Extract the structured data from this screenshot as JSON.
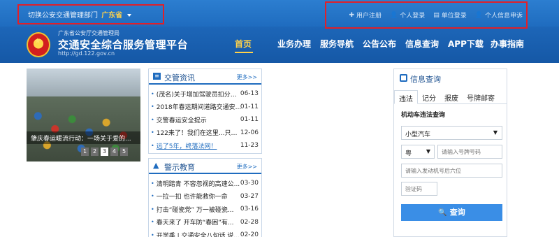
{
  "topbar": {
    "dept_prefix": "切换公安交通管理部门",
    "dept_province": "广东省",
    "links": [
      {
        "icon": "plus-icon",
        "label": "用户注册"
      },
      {
        "icon": "user-icon",
        "label": "个人登录"
      },
      {
        "icon": "building-icon",
        "label": "单位登录"
      },
      {
        "icon": "user-info-icon",
        "label": "个人信息申诉"
      }
    ]
  },
  "header": {
    "org": "广东省公安厅交通管理局",
    "title": "交通安全综合服务管理平台",
    "url": "http://gd.122.gov.cn"
  },
  "nav": [
    "首页",
    "业务办理",
    "服务导航",
    "公告公布",
    "信息查询",
    "APP下载",
    "办事指南"
  ],
  "carousel": {
    "caption": "肇庆春运暖流行动：一场关于爱的...",
    "pages": [
      "1",
      "2",
      "3",
      "4",
      "5"
    ],
    "active_page": 3
  },
  "news": {
    "title": "交管资讯",
    "more": "更多>>",
    "items": [
      {
        "title": "(茂名)关于增加驾驶员扣分、...",
        "date": "06-13"
      },
      {
        "title": "2018年春运期间道路交通安...",
        "date": "01-11"
      },
      {
        "title": "交警春运安全提示",
        "date": "01-11"
      },
      {
        "title": "122来了！我们在这里...只为...",
        "date": "12-06"
      },
      {
        "title": "远了5年，终落法网！",
        "date": "11-23"
      }
    ]
  },
  "warning": {
    "title": "警示教育",
    "more": "更多>>",
    "items": [
      {
        "title": "清明踏青 不容忽视的高速公...",
        "date": "03-30"
      },
      {
        "title": "一拉一扣 也许能救你一命",
        "date": "03-27"
      },
      {
        "title": "打击“碰瓷党” 万一被碰瓷...",
        "date": "03-16"
      },
      {
        "title": "春天来了 开车防“春困”有...",
        "date": "02-28"
      },
      {
        "title": "开学季 | 交通安全八句话 说...",
        "date": "02-20"
      }
    ]
  },
  "query": {
    "title": "信息查询",
    "tabs": [
      "违法",
      "记分",
      "报废",
      "号牌邮寄"
    ],
    "subtitle": "机动车违法查询",
    "vehicle_type": "小型汽车",
    "plate_prefix": "粤",
    "plate_placeholder": "请输入号牌号码",
    "engine_placeholder": "请输入发动机号后六位",
    "captcha_placeholder": "验证码",
    "button": "查询"
  }
}
